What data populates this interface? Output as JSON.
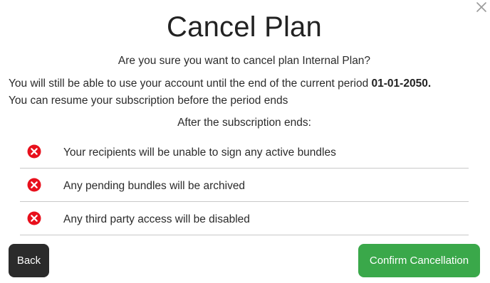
{
  "dialog": {
    "title": "Cancel Plan",
    "question": "Are you sure you want to cancel plan Internal Plan?",
    "still_able_prefix": "You will still be able to use your account until the end of the current period ",
    "period_end_date": "01-01-2050.",
    "resume_text": "You can resume your subscription before the period ends",
    "after_heading": "After the subscription ends:",
    "consequences": [
      {
        "text": "Your recipients will be unable to sign any active bundles",
        "icon": "error-x-icon"
      },
      {
        "text": "Any pending bundles will be archived",
        "icon": "error-x-icon"
      },
      {
        "text": "Any third party access will be disabled",
        "icon": "error-x-icon"
      }
    ],
    "close_icon": "close-icon"
  },
  "buttons": {
    "back_label": "Back",
    "confirm_label": "Confirm Cancellation"
  },
  "colors": {
    "error_red": "#e8101c",
    "confirm_green": "#3aa84a",
    "back_dark": "#2b2b2b",
    "close_gray": "#9a9a9a"
  }
}
